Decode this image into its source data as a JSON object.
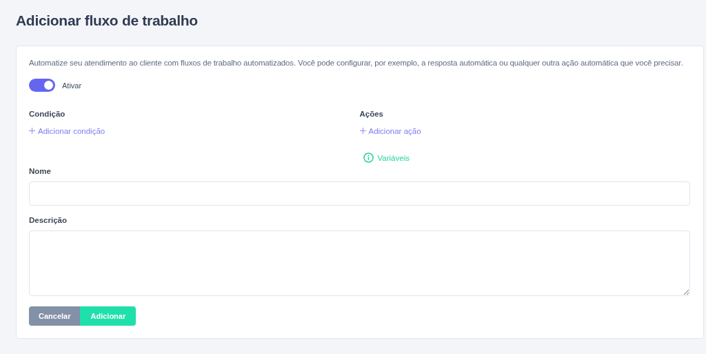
{
  "title": "Adicionar fluxo de trabalho",
  "description": "Automatize seu atendimento ao cliente com fluxos de trabalho automatizados. Você pode configurar, por exemplo, a resposta automática ou qualquer outra ação automática que você precisar.",
  "toggle": {
    "label": "Ativar",
    "on": true
  },
  "conditions": {
    "heading": "Condição",
    "add_label": "Adicionar condição"
  },
  "actions": {
    "heading": "Ações",
    "add_label": "Adicionar ação",
    "variables_label": "Variáveis"
  },
  "fields": [
    {
      "label": "Nome",
      "kind": "input"
    },
    {
      "label": "Descrição",
      "kind": "textarea"
    }
  ],
  "buttons": [
    {
      "label": "Cancelar",
      "kind": "secondary"
    },
    {
      "label": "Adicionar",
      "kind": "primary"
    }
  ]
}
